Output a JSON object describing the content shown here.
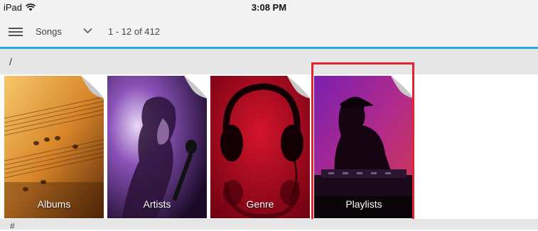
{
  "status_bar": {
    "device": "iPad",
    "time": "3:08 PM"
  },
  "toolbar": {
    "view": "Songs",
    "count": "1 - 12 of 412"
  },
  "breadcrumb": {
    "path": "/"
  },
  "tiles": [
    {
      "label": "Albums"
    },
    {
      "label": "Artists"
    },
    {
      "label": "Genre"
    },
    {
      "label": "Playlists",
      "selected": true
    }
  ],
  "footer": {
    "text": "#"
  },
  "colors": {
    "accent": "#2aa7df",
    "selection": "#e52330"
  }
}
